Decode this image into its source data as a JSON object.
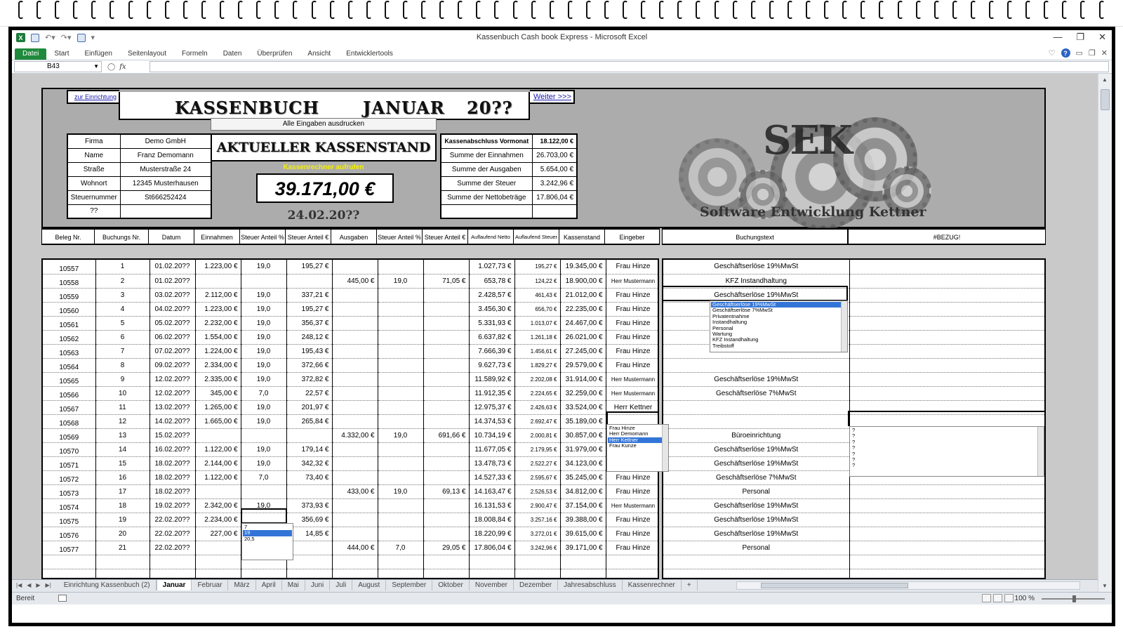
{
  "window": {
    "title": "Kassenbuch Cash book Express  -  Microsoft Excel"
  },
  "ribbon": {
    "tabs": [
      "Datei",
      "Start",
      "Einfügen",
      "Seitenlayout",
      "Formeln",
      "Daten",
      "Überprüfen",
      "Ansicht",
      "Entwicklertools"
    ]
  },
  "formula_bar": {
    "name_box": "B43",
    "fx": "fx",
    "value": ""
  },
  "sheet": {
    "link_setup": "zur Einrichtung",
    "link_next": "Weiter >>>",
    "title_word": "KASSENBUCH",
    "month": "JANUAR",
    "year": "20??",
    "print_button": "Alle Eingaben ausdrucken",
    "current_balance_title": "AKTUELLER KASSENSTAND",
    "calculator_link": "Kassenrechner aufrufen",
    "current_balance": "39.171,00 €",
    "current_date": "24.02.20??",
    "company": [
      {
        "label": "Firma",
        "value": "Demo GmbH"
      },
      {
        "label": "Name",
        "value": "Franz Demomann"
      },
      {
        "label": "Straße",
        "value": "Musterstraße 24"
      },
      {
        "label": "Wohnort",
        "value": "12345 Musterhausen"
      },
      {
        "label": "Steuernummer",
        "value": "St666252424"
      },
      {
        "label": "??",
        "value": ""
      }
    ],
    "summary": [
      {
        "label": "Kassenabschluss Vormonat",
        "value": "18.122,00 €"
      },
      {
        "label": "Summe der Einnahmen",
        "value": "26.703,00 €"
      },
      {
        "label": "Summe der Ausgaben",
        "value": "5.654,00 €"
      },
      {
        "label": "Summe der Steuer",
        "value": "3.242,96 €"
      },
      {
        "label": "Summe der Nettobeträge",
        "value": "17.806,04 €"
      },
      {
        "label": "",
        "value": ""
      }
    ],
    "logo": {
      "text": "SEK",
      "subtitle": "Software Entwicklung Kettner"
    },
    "columns": [
      "Beleg Nr.",
      "Buchungs Nr.",
      "Datum",
      "Einnahmen",
      "Steuer Anteil %",
      "Steuer Anteil €",
      "Ausgaben",
      "Steuer Anteil %",
      "Steuer Anteil €",
      "Auflaufend Netto",
      "Auflaufend Steuer",
      "Kassenstand",
      "Eingeber"
    ],
    "right_columns": [
      "Buchungstext",
      "#BEZUG!"
    ],
    "rows": [
      [
        "10557",
        "1",
        "01.02.20??",
        "1.223,00 €",
        "19,0",
        "195,27 €",
        "",
        "",
        "",
        "1.027,73 €",
        "195,27 €",
        "19.345,00 €",
        "Frau Hinze",
        "Geschäftserlöse 19%MwSt"
      ],
      [
        "10558",
        "2",
        "01.02.20??",
        "",
        "",
        "",
        "445,00 €",
        "19,0",
        "71,05 €",
        "653,78 €",
        "124,22 €",
        "18.900,00 €",
        "Herr Mustermann",
        "KFZ Instandhaltung"
      ],
      [
        "10559",
        "3",
        "03.02.20??",
        "2.112,00 €",
        "19,0",
        "337,21 €",
        "",
        "",
        "",
        "2.428,57 €",
        "461,43 €",
        "21.012,00 €",
        "Frau Hinze",
        "Geschäftserlöse 19%MwSt"
      ],
      [
        "10560",
        "4",
        "04.02.20??",
        "1.223,00 €",
        "19,0",
        "195,27 €",
        "",
        "",
        "",
        "3.456,30 €",
        "656,70 €",
        "22.235,00 €",
        "Frau Hinze",
        ""
      ],
      [
        "10561",
        "5",
        "05.02.20??",
        "2.232,00 €",
        "19,0",
        "356,37 €",
        "",
        "",
        "",
        "5.331,93 €",
        "1.013,07 €",
        "24.467,00 €",
        "Frau Hinze",
        ""
      ],
      [
        "10562",
        "6",
        "06.02.20??",
        "1.554,00 €",
        "19,0",
        "248,12 €",
        "",
        "",
        "",
        "6.637,82 €",
        "1.261,18 €",
        "26.021,00 €",
        "Frau Hinze",
        ""
      ],
      [
        "10563",
        "7",
        "07.02.20??",
        "1.224,00 €",
        "19,0",
        "195,43 €",
        "",
        "",
        "",
        "7.666,39 €",
        "1.456,61 €",
        "27.245,00 €",
        "Frau Hinze",
        ""
      ],
      [
        "10564",
        "8",
        "09.02.20??",
        "2.334,00 €",
        "19,0",
        "372,66 €",
        "",
        "",
        "",
        "9.627,73 €",
        "1.829,27 €",
        "29.579,00 €",
        "Frau Hinze",
        ""
      ],
      [
        "10565",
        "9",
        "12.02.20??",
        "2.335,00 €",
        "19,0",
        "372,82 €",
        "",
        "",
        "",
        "11.589,92 €",
        "2.202,08 €",
        "31.914,00 €",
        "Herr Mustermann",
        "Geschäftserlöse 19%MwSt"
      ],
      [
        "10566",
        "10",
        "12.02.20??",
        "345,00 €",
        "7,0",
        "22,57 €",
        "",
        "",
        "",
        "11.912,35 €",
        "2.224,65 €",
        "32.259,00 €",
        "Herr Mustermann",
        "Geschäftserlöse 7%MwSt"
      ],
      [
        "10567",
        "11",
        "13.02.20??",
        "1.265,00 €",
        "19,0",
        "201,97 €",
        "",
        "",
        "",
        "12.975,37 €",
        "2.426,63 €",
        "33.524,00 €",
        "Herr Kettner",
        ""
      ],
      [
        "10568",
        "12",
        "14.02.20??",
        "1.665,00 €",
        "19,0",
        "265,84 €",
        "",
        "",
        "",
        "14.374,53 €",
        "2.692,47 €",
        "35.189,00 €",
        "",
        ""
      ],
      [
        "10569",
        "13",
        "15.02.20??",
        "",
        "",
        "",
        "4.332,00 €",
        "19,0",
        "691,66 €",
        "10.734,19 €",
        "2.000,81 €",
        "30.857,00 €",
        "",
        "Büroeinrichtung"
      ],
      [
        "10570",
        "14",
        "16.02.20??",
        "1.122,00 €",
        "19,0",
        "179,14 €",
        "",
        "",
        "",
        "11.677,05 €",
        "2.179,95 €",
        "31.979,00 €",
        "",
        "Geschäftserlöse 19%MwSt"
      ],
      [
        "10571",
        "15",
        "18.02.20??",
        "2.144,00 €",
        "19,0",
        "342,32 €",
        "",
        "",
        "",
        "13.478,73 €",
        "2.522,27 €",
        "34.123,00 €",
        "Frau Hinze",
        "Geschäftserlöse 19%MwSt"
      ],
      [
        "10572",
        "16",
        "18.02.20??",
        "1.122,00 €",
        "7,0",
        "73,40 €",
        "",
        "",
        "",
        "14.527,33 €",
        "2.595,67 €",
        "35.245,00 €",
        "Frau Hinze",
        "Geschäftserlöse 7%MwSt"
      ],
      [
        "10573",
        "17",
        "18.02.20??",
        "",
        "",
        "",
        "433,00 €",
        "19,0",
        "69,13 €",
        "14.163,47 €",
        "2.526,53 €",
        "34.812,00 €",
        "Frau Hinze",
        "Personal"
      ],
      [
        "10574",
        "18",
        "19.02.20??",
        "2.342,00 €",
        "19,0",
        "373,93 €",
        "",
        "",
        "",
        "16.131,53 €",
        "2.900,47 €",
        "37.154,00 €",
        "Herr Mustermann",
        "Geschäftserlöse 19%MwSt"
      ],
      [
        "10575",
        "19",
        "22.02.20??",
        "2.234,00 €",
        "",
        "356,69 €",
        "",
        "",
        "",
        "18.008,84 €",
        "3.257,16 €",
        "39.388,00 €",
        "Frau Hinze",
        "Geschäftserlöse 19%MwSt"
      ],
      [
        "10576",
        "20",
        "22.02.20??",
        "227,00 €",
        "",
        "14,85 €",
        "",
        "",
        "",
        "18.220,99 €",
        "3.272,01 €",
        "39.615,00 €",
        "Frau Hinze",
        "Geschäftserlöse 19%MwSt"
      ],
      [
        "10577",
        "21",
        "22.02.20??",
        "",
        "",
        "",
        "444,00 €",
        "7,0",
        "29,05 €",
        "17.806,04 €",
        "3.242,96 €",
        "39.171,00 €",
        "Frau Hinze",
        "Personal"
      ],
      [
        "",
        "",
        "",
        "",
        "",
        "",
        "",
        "",
        "",
        "",
        "",
        "",
        "",
        ""
      ],
      [
        "",
        "",
        "",
        "",
        "",
        "",
        "",
        "",
        "",
        "",
        "",
        "",
        "",
        ""
      ]
    ],
    "dropdown_buchungstext": [
      "Geschäftserlöse 19%MwSt",
      "Geschäftserlöse 7%MwSt",
      "Privatentnahme",
      "Instandhaltung",
      "Personal",
      "Wartung",
      "KFZ Instandhaltung",
      "Treibstoff"
    ],
    "dropdown_eingeber": [
      "Frau Hinze",
      "Herr Demomann",
      "Herr Kettner",
      "Frau Kunze"
    ],
    "dropdown_steuer": [
      "7",
      "19",
      "20,5"
    ],
    "dropdown_bezug": [
      "",
      "?",
      "?",
      "?",
      "?",
      "?",
      "?",
      "?"
    ]
  },
  "sheet_tabs": [
    "Einrichtung Kassenbuch (2)",
    "Januar",
    "Februar",
    "März",
    "April",
    "Mai",
    "Juni",
    "Juli",
    "August",
    "September",
    "Oktober",
    "November",
    "Dezember",
    "Jahresabschluss",
    "Kassenrechner"
  ],
  "status": {
    "ready": "Bereit",
    "zoom": "100 %"
  }
}
